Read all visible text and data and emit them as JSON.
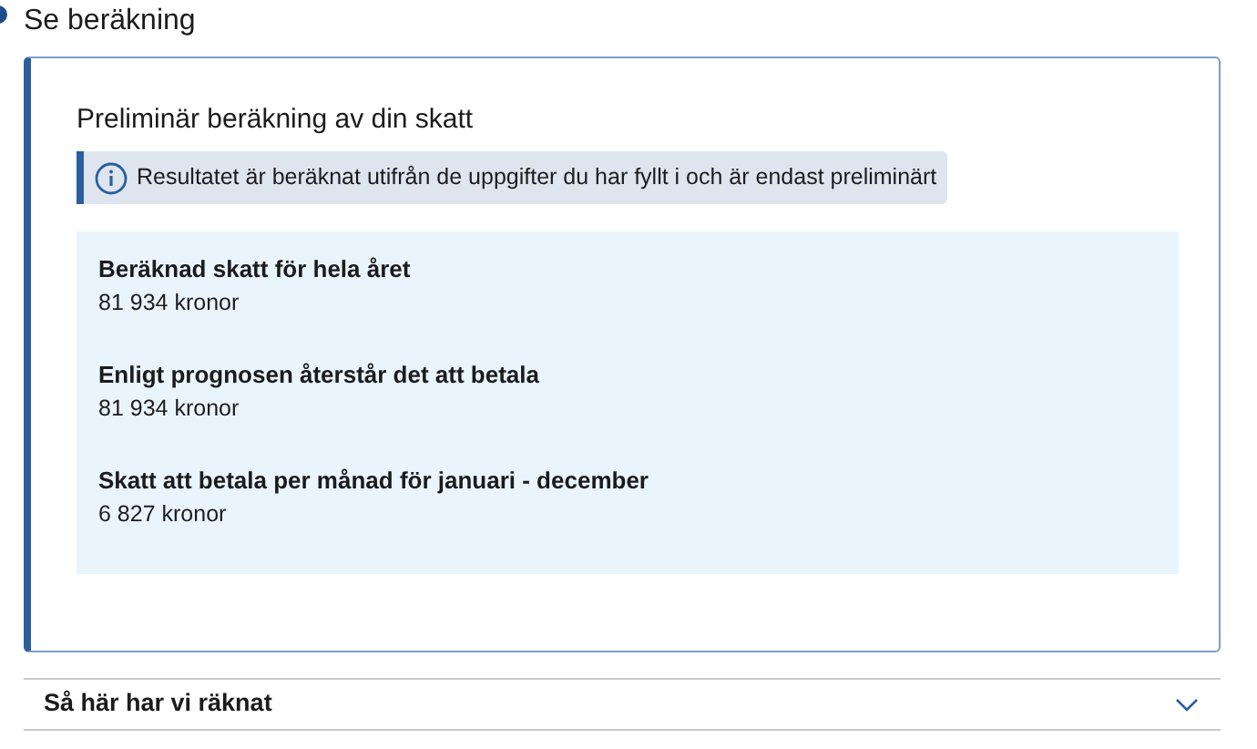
{
  "section": {
    "title": "Se beräkning"
  },
  "card": {
    "title": "Preliminär beräkning av din skatt",
    "info": "Resultatet är beräknat utifrån de uppgifter du har fyllt i och är endast preliminärt",
    "results": [
      {
        "label": "Beräknad skatt för hela året",
        "value": "81 934 kronor"
      },
      {
        "label": "Enligt prognosen återstår det att betala",
        "value": "81 934 kronor"
      },
      {
        "label": "Skatt att betala per månad för januari - december",
        "value": "6 827 kronor"
      }
    ]
  },
  "accordion": {
    "title": "Så här har vi räknat",
    "expanded": false
  }
}
